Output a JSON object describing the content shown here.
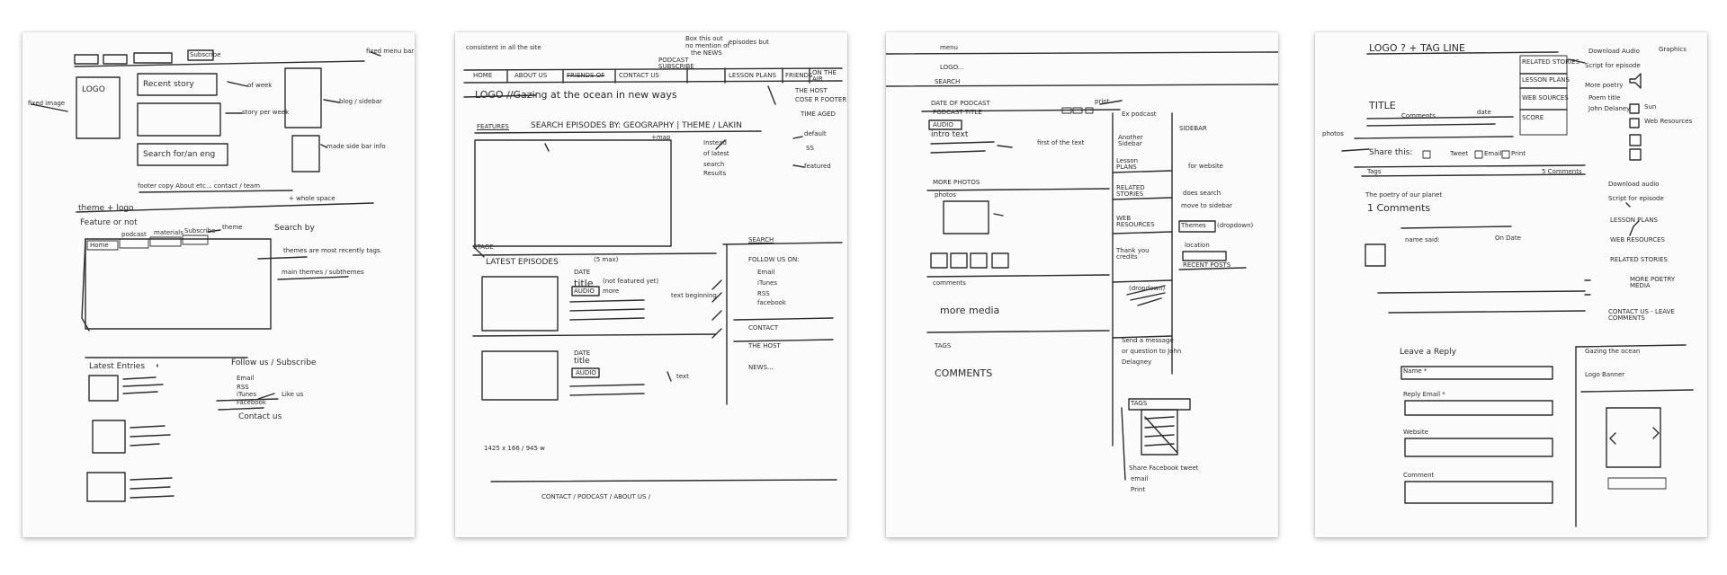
{
  "sheet1": {
    "subscribe": "Subscribe",
    "fixed_menu_bar": "fixed menu bar",
    "logo": "LOGO",
    "recent_story": "Recent story",
    "of_week": "of week",
    "fixed_image": "fixed image",
    "story_per_week": "story per week",
    "blog_sidebar": "blog / sidebar",
    "search_for_podcast": "Search for/an eng",
    "made_side_bar_info": "made side bar info",
    "footer_links": "footer copy  About etc... contact / team",
    "white_space": "+ whole space",
    "theme_logo": "theme + logo",
    "feature_or_not": "Feature or not",
    "tabs": [
      "Home",
      "podcast",
      "materials",
      "Subscribe"
    ],
    "theme": "theme",
    "search_by": "Search by",
    "themes_note": "themes are most recently tags.",
    "main_themes": "main themes / subthemes",
    "latest_entries": "Latest Entries",
    "follow_us": "Follow us / Subscribe",
    "follow_links": [
      "Email",
      "RSS",
      "iTunes",
      "Facebook"
    ],
    "like_us": "Like us",
    "contact_us": "Contact us"
  },
  "sheet2": {
    "annotation_top_left": "consistent in all the site",
    "annotation_top_right": [
      "Box this out",
      "no mention of",
      "episodes but",
      "the NEWS"
    ],
    "nav": [
      "HOME",
      "ABOUT US",
      "FRIENDS OF",
      "CONTACT US",
      "PODCAST SUBSCRIBE",
      "LESSON PLANS",
      "FRIENDS",
      "ON THE AIR"
    ],
    "the_host": "THE HOST",
    "cohost": "COSE R FOOTER",
    "logo_tagline": "LOGO //Gazing at the ocean in new ways",
    "time_aged": "TIME AGED",
    "features": "FEATURES",
    "search_episodes": "SEARCH EPISODES BY:  GEOGRAPHY  |  THEME  /  LAKIN",
    "map": "+map",
    "default": "default",
    "ss": "SS",
    "featured": "featured",
    "instead_note": [
      "Instead",
      "of latest",
      "search",
      "Results"
    ],
    "stage": "STAGE",
    "search": "SEARCH",
    "latest_episodes": "LATEST EPISODES",
    "max": "(5 max)",
    "date": "DATE",
    "title": "title",
    "not_featured": "(not featured yet)",
    "audio": "AUDIO",
    "more": "more",
    "text_beginning": "text beginning",
    "text": "text",
    "follow_us_on": "FOLLOW US ON:",
    "follow_links": [
      "Email",
      "iTunes",
      "RSS",
      "facebook"
    ],
    "contact": "CONTACT",
    "host": "THE HOST",
    "news": "NEWS...",
    "dims": "1425 x 166  / 945 w",
    "footer": "CONTACT  /  PODCAST  /  ABOUT US /"
  },
  "sheet3": {
    "menu": "menu",
    "logo": "LOGO...",
    "search": "SEARCH",
    "date_of_podcast": "DATE OF PODCAST",
    "podcast_title": "PODCAST TITLE",
    "print": "print",
    "ex_podcast": "Ex podcast",
    "audio": "AUDIO",
    "intro_text": "intro text",
    "first_of_text": "first of the text",
    "another_sidebar": "Another Sidebar",
    "sidebar": "SIDEBAR",
    "for_website": "for website",
    "lesson_plans": "Lesson PLANS",
    "does_search": "does search",
    "move_to_sidebar": "move to sidebar",
    "related_stories": "RELATED STORIES",
    "more_photos": "MORE PHOTOS",
    "photos": "photos",
    "web_resources": "WEB RESOURCES",
    "themes": "Themes",
    "dropdown": "(dropdown)",
    "location": "location",
    "thank_you_credits": "Thank you credits",
    "recent_posts": "RECENT POSTS",
    "comments_label": "comments",
    "more_media": "more media",
    "tags_dropdown": "(dropdown)",
    "tags": "TAGS",
    "tags_btn": "TAGS",
    "comments": "COMMENTS",
    "send_message": [
      "Send a message",
      "or question to John",
      "Delagney"
    ],
    "share": "Share  Facebook  tweet",
    "email": "email",
    "print2": "Print"
  },
  "sheet4": {
    "logo_tagline": "LOGO ? + TAG LINE",
    "related_stories": "RELATED STORIES",
    "lesson_plans": "LESSON PLANS",
    "web_sources": "WEB SOURCES",
    "score": "SCORE",
    "download_audio": "Download Audio",
    "script": "Script for episode",
    "graphics": "Graphics",
    "more_poetry": "More poetry",
    "poem_title": "Poem title",
    "john_delaney": "John Delaney",
    "title": "TITLE",
    "comments_small": "Comments",
    "date": "date",
    "photos": "photos",
    "share_this": "Share this:",
    "tweet": "Tweet",
    "email": "Email",
    "print": "Print",
    "tags": "Tags",
    "comments_count": "5 Comments",
    "poetry_note": "The poetry of our planet",
    "comments_heading": "1 Comments",
    "name_said": "name said:",
    "on_date": "On Date",
    "checklist": [
      "Download audio",
      "Script for episode",
      "LESSON PLANS",
      "WEB RESOURCES",
      "RELATED STORIES",
      "MORE POETRY MEDIA",
      "CONTACT US - LEAVE COMMENTS"
    ],
    "leave_reply": "Leave a Reply",
    "name": "Name *",
    "email_field": "Reply Email *",
    "website": "Website",
    "comment": "Comment",
    "sidebar_1": "Gazing the ocean",
    "sidebar_2": "Logo Banner",
    "side_icons": [
      "Sun",
      "Web Resources"
    ]
  }
}
